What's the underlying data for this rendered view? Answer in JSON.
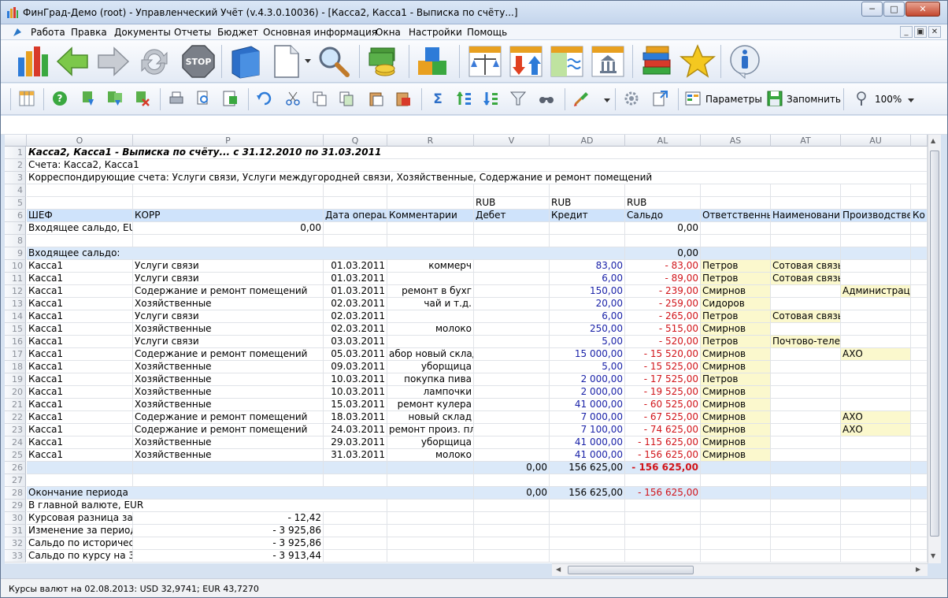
{
  "window": {
    "title": "ФинГрад-Демо (root)  -  Управленческий Учёт (v.4.3.0.10036) - [Касса2, Касса1 - Выписка по счёту...]"
  },
  "menu": [
    {
      "label": "Работа"
    },
    {
      "label": "Правка"
    },
    {
      "label": "Документы"
    },
    {
      "label": "Отчеты"
    },
    {
      "label": "Бюджет"
    },
    {
      "label": "Основная информация"
    },
    {
      "label": "Окна"
    },
    {
      "label": "Настройки"
    },
    {
      "label": "Помощь"
    }
  ],
  "toolbar": {
    "params_label": "Параметры",
    "save_label": "Запомнить",
    "zoom": "100%"
  },
  "columns": [
    "O",
    "P",
    "Q",
    "R",
    "V",
    "AD",
    "AL",
    "AS",
    "AT",
    "AU"
  ],
  "rows": {
    "r1": "Касса2, Касса1 - Выписка по счёту... с 31.12.2010 по 31.03.2011",
    "r2": "Счета:  Касса2,  Касса1",
    "r3": "Корреспондирующие счета:  Услуги связи,  Услуги междугородней связи,  Хозяйственные,  Содержание и ремонт помещений",
    "r5": [
      "RUB",
      "RUB",
      "RUB"
    ],
    "r6": [
      "ШЕФ",
      "КОРР",
      "Дата операц",
      "Комментарии",
      "Дебет",
      "Кредит",
      "Сальдо",
      "Ответственный",
      "Наименование",
      "Производстве",
      "Ко"
    ],
    "r7": [
      "Входящее сальдо, EU",
      "0,00",
      "0,00"
    ],
    "r9": [
      "Входящее сальдо:",
      "0,00"
    ],
    "data": [
      {
        "n": "10",
        "o": "Касса1",
        "p": "Услуги связи",
        "q": "01.03.2011",
        "r": "коммерч",
        "ad": "83,00",
        "al": "-    83,00",
        "as": "Петров",
        "at": "Сотовая связь",
        "au": ""
      },
      {
        "n": "11",
        "o": "Касса1",
        "p": "Услуги связи",
        "q": "01.03.2011",
        "r": "",
        "ad": "6,00",
        "al": "-    89,00",
        "as": "Петров",
        "at": "Сотовая связь",
        "au": ""
      },
      {
        "n": "12",
        "o": "Касса1",
        "p": "Содержание и ремонт помещений",
        "q": "01.03.2011",
        "r": "ремонт в бухг",
        "ad": "150,00",
        "al": "-    239,00",
        "as": "Смирнов",
        "at": "",
        "au": "Администрация"
      },
      {
        "n": "13",
        "o": "Касса1",
        "p": "Хозяйственные",
        "q": "02.03.2011",
        "r": "чай и т.д.",
        "ad": "20,00",
        "al": "-    259,00",
        "as": "Сидоров",
        "at": "",
        "au": ""
      },
      {
        "n": "14",
        "o": "Касса1",
        "p": "Услуги связи",
        "q": "02.03.2011",
        "r": "",
        "ad": "6,00",
        "al": "-    265,00",
        "as": "Петров",
        "at": "Сотовая связь",
        "au": ""
      },
      {
        "n": "15",
        "o": "Касса1",
        "p": "Хозяйственные",
        "q": "02.03.2011",
        "r": "молоко",
        "ad": "250,00",
        "al": "-    515,00",
        "as": "Смирнов",
        "at": "",
        "au": ""
      },
      {
        "n": "16",
        "o": "Касса1",
        "p": "Услуги связи",
        "q": "03.03.2011",
        "r": "",
        "ad": "5,00",
        "al": "-    520,00",
        "as": "Петров",
        "at": "Почтово-телеграфные",
        "au": ""
      },
      {
        "n": "17",
        "o": "Касса1",
        "p": "Содержание и ремонт помещений",
        "q": "05.03.2011",
        "r": "абор новый склад",
        "ad": "15 000,00",
        "al": "-  15 520,00",
        "as": "Смирнов",
        "at": "",
        "au": "АХО"
      },
      {
        "n": "18",
        "o": "Касса1",
        "p": "Хозяйственные",
        "q": "09.03.2011",
        "r": "уборщица",
        "ad": "5,00",
        "al": "-  15 525,00",
        "as": "Смирнов",
        "at": "",
        "au": ""
      },
      {
        "n": "19",
        "o": "Касса1",
        "p": "Хозяйственные",
        "q": "10.03.2011",
        "r": "покупка пива",
        "ad": "2 000,00",
        "al": "-  17 525,00",
        "as": "Петров",
        "at": "",
        "au": ""
      },
      {
        "n": "20",
        "o": "Касса1",
        "p": "Хозяйственные",
        "q": "10.03.2011",
        "r": "лампочки",
        "ad": "2 000,00",
        "al": "-  19 525,00",
        "as": "Смирнов",
        "at": "",
        "au": ""
      },
      {
        "n": "21",
        "o": "Касса1",
        "p": "Хозяйственные",
        "q": "15.03.2011",
        "r": "ремонт кулера",
        "ad": "41 000,00",
        "al": "-  60 525,00",
        "as": "Смирнов",
        "at": "",
        "au": ""
      },
      {
        "n": "22",
        "o": "Касса1",
        "p": "Содержание и ремонт помещений",
        "q": "18.03.2011",
        "r": "новый склад",
        "ad": "7 000,00",
        "al": "-  67 525,00",
        "as": "Смирнов",
        "at": "",
        "au": "АХО"
      },
      {
        "n": "23",
        "o": "Касса1",
        "p": "Содержание и ремонт помещений",
        "q": "24.03.2011",
        "r": "ремонт произ. пл.",
        "ad": "7 100,00",
        "al": "-  74 625,00",
        "as": "Смирнов",
        "at": "",
        "au": "АХО"
      },
      {
        "n": "24",
        "o": "Касса1",
        "p": "Хозяйственные",
        "q": "29.03.2011",
        "r": "уборщица",
        "ad": "41 000,00",
        "al": "-  115 625,00",
        "as": "Смирнов",
        "at": "",
        "au": ""
      },
      {
        "n": "25",
        "o": "Касса1",
        "p": "Хозяйственные",
        "q": "31.03.2011",
        "r": "молоко",
        "ad": "41 000,00",
        "al": "-  156 625,00",
        "as": "Смирнов",
        "at": "",
        "au": ""
      }
    ],
    "r26": [
      "0,00",
      "156 625,00",
      "-  156 625,00"
    ],
    "r28": [
      "Окончание периода",
      "0,00",
      "156 625,00",
      "-  156 625,00"
    ],
    "r29": "В главной валюте, EUR",
    "r30": [
      "Курсовая разница за п",
      "-    12,42"
    ],
    "r31": [
      "Изменение за период:",
      "-  3 925,86"
    ],
    "r32": [
      "Сальдо по историческ",
      "-  3 925,86"
    ],
    "r33": [
      "Сальдо по курсу на 31",
      "-  3 913,44"
    ]
  },
  "status": "Курсы валют на 02.08.2013:  USD 32,9741;  EUR 43,7270"
}
